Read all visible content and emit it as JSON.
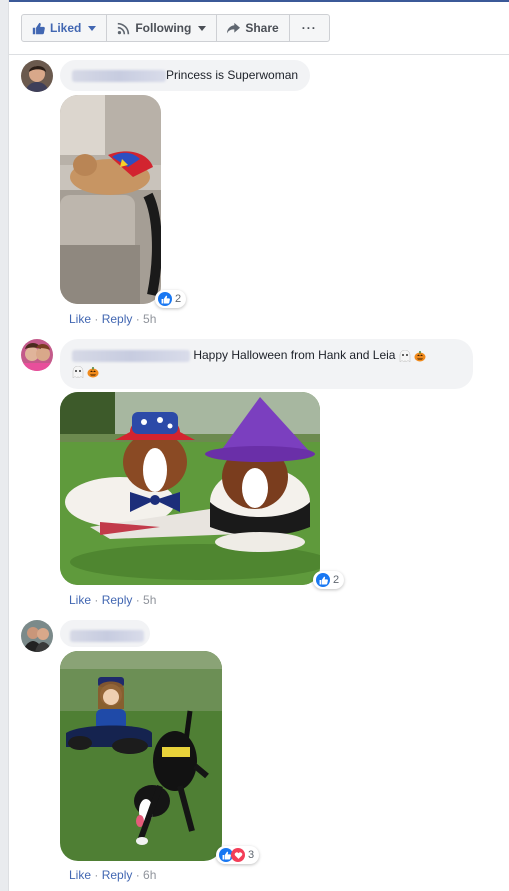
{
  "action_bar": {
    "liked_label": "Liked",
    "following_label": "Following",
    "share_label": "Share",
    "more_label": "···"
  },
  "comments": [
    {
      "text": "Princess is Superwoman",
      "reaction_count": "2",
      "like_label": "Like",
      "reply_label": "Reply",
      "time": "5h"
    },
    {
      "text": "Happy Halloween from Hank and Leia",
      "reaction_count": "2",
      "like_label": "Like",
      "reply_label": "Reply",
      "time": "5h"
    },
    {
      "text": "",
      "reaction_count": "3",
      "like_label": "Like",
      "reply_label": "Reply",
      "time": "6h"
    }
  ],
  "colors": {
    "accent": "#4267b2",
    "like_blue": "#1877f2",
    "love_red": "#f33e58",
    "bubble_bg": "#f2f3f5"
  }
}
